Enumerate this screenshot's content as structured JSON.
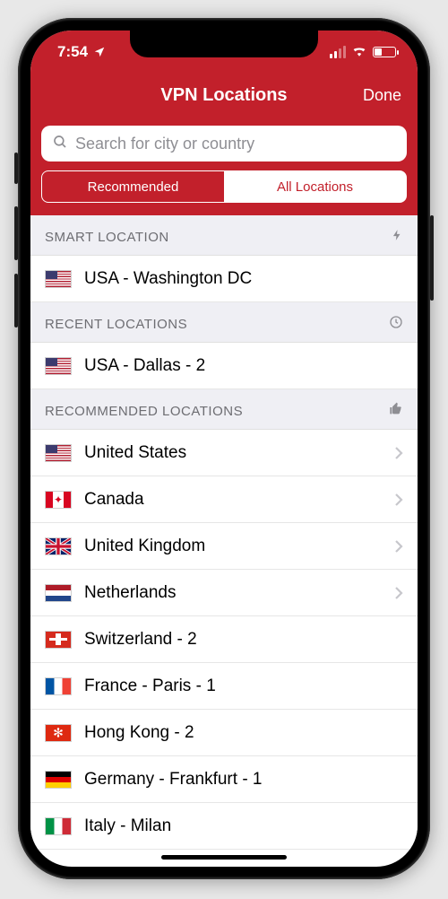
{
  "status": {
    "time": "7:54",
    "signal_bars": 2
  },
  "header": {
    "title": "VPN Locations",
    "done": "Done"
  },
  "search": {
    "placeholder": "Search for city or country"
  },
  "tabs": {
    "recommended": "Recommended",
    "all": "All Locations",
    "active": "recommended"
  },
  "sections": {
    "smart": {
      "title": "SMART LOCATION"
    },
    "recent": {
      "title": "RECENT LOCATIONS"
    },
    "recommended": {
      "title": "RECOMMENDED LOCATIONS"
    }
  },
  "smart": {
    "label": "USA - Washington DC",
    "flag": "us"
  },
  "recent": [
    {
      "label": "USA - Dallas - 2",
      "flag": "us"
    }
  ],
  "recommended": [
    {
      "label": "United States",
      "flag": "us",
      "chevron": true
    },
    {
      "label": "Canada",
      "flag": "ca",
      "chevron": true
    },
    {
      "label": "United Kingdom",
      "flag": "uk",
      "chevron": true
    },
    {
      "label": "Netherlands",
      "flag": "nl",
      "chevron": true
    },
    {
      "label": "Switzerland - 2",
      "flag": "ch",
      "chevron": false
    },
    {
      "label": "France - Paris - 1",
      "flag": "fr",
      "chevron": false
    },
    {
      "label": "Hong Kong - 2",
      "flag": "hk",
      "chevron": false
    },
    {
      "label": "Germany - Frankfurt - 1",
      "flag": "de",
      "chevron": false
    },
    {
      "label": "Italy - Milan",
      "flag": "it",
      "chevron": false
    }
  ]
}
